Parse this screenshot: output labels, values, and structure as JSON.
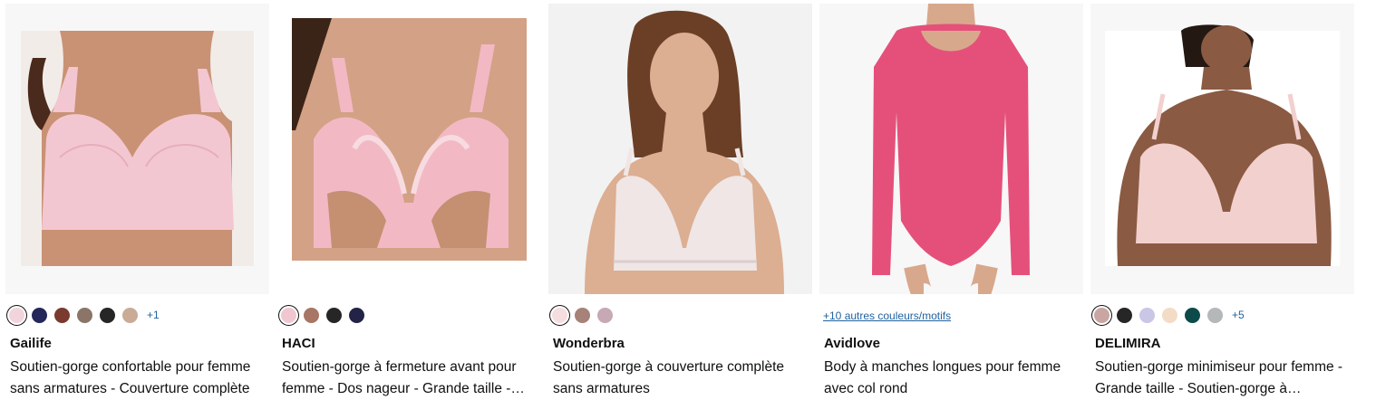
{
  "products": [
    {
      "brand": "Gailife",
      "title": "Soutien-gorge confortable pour femme sans armatures - Couverture complète",
      "swatches": [
        "#f2d4dc",
        "#24275a",
        "#7a3a2e",
        "#8a7568",
        "#262626",
        "#c9ab96"
      ],
      "more_label": "+1",
      "image": {
        "bg": "#ffffff",
        "skin": "#c99274",
        "garment": "#f3c7d1",
        "hair": "#4a2a1c"
      }
    },
    {
      "brand": "HACI",
      "title": "Soutien-gorge à fermeture avant pour femme - Dos nageur - Grande taille - Sans armatures",
      "swatches": [
        "#f0c7d0",
        "#a77665",
        "#262626",
        "#232347"
      ],
      "more_label": "",
      "image": {
        "bg": "#ffffff",
        "skin": "#d3a185",
        "garment": "#f2b9c4",
        "hair": "#3a2418"
      }
    },
    {
      "brand": "Wonderbra",
      "title": "Soutien-gorge à couverture complète sans armatures",
      "swatches": [
        "#f6dde0",
        "#a68279",
        "#c6a9b4"
      ],
      "more_label": "",
      "image": {
        "bg": "#f2f2f2",
        "skin": "#dcae92",
        "garment": "#efe6e5",
        "hair": "#6b3f26"
      }
    },
    {
      "brand": "Avidlove",
      "title": "Body à manches longues pour femme avec col rond",
      "swatches": [],
      "more_label": "+10 autres couleurs/motifs",
      "image": {
        "bg": "#f7f7f7",
        "skin": "#d8a88c",
        "garment": "#e5507a",
        "hair": "#3b2a20"
      }
    },
    {
      "brand": "DELIMIRA",
      "title": "Soutien-gorge minimiseur pour femme - Grande taille - Soutien-gorge à armatures",
      "swatches": [
        "#c9a6a2",
        "#262626",
        "#c9c6e6",
        "#f3dcc6",
        "#0d4b4a",
        "#b5b8b8"
      ],
      "more_label": "+5",
      "image": {
        "bg": "#ffffff",
        "skin": "#8a5a42",
        "garment": "#f2d0ce",
        "hair": "#231812"
      }
    }
  ]
}
